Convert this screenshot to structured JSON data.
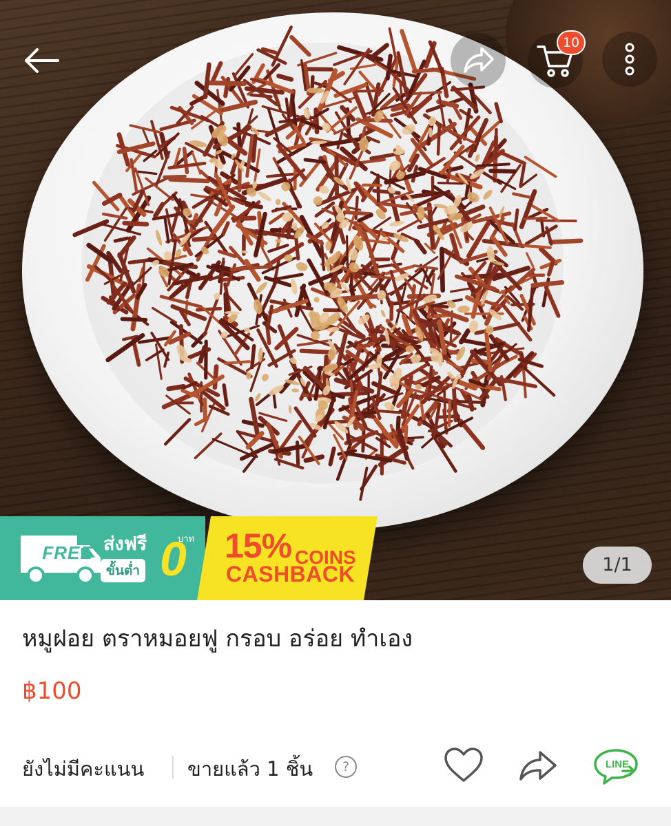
{
  "header": {
    "cart_count": "10",
    "icons": [
      "back-arrow-icon",
      "share-icon",
      "cart-icon",
      "more-vertical-icon"
    ]
  },
  "gallery": {
    "page_indicator": "1/1"
  },
  "promo": {
    "free_label": "FREE",
    "ship_free": "ส่งฟรี",
    "min_label": "ขั้นต่ำ",
    "zero": "0",
    "baht": "บาท",
    "cashback_pct": "15%",
    "cashback_coins": "COINS",
    "cashback_word": "CASHBACK",
    "colors": {
      "green": "#41b79b",
      "yellow": "#f7e324",
      "accent": "#ee4d2d"
    }
  },
  "product": {
    "title": "หมูฝอย ตราหมอยฟู กรอบ อร่อย ทำเอง",
    "price": "฿100",
    "rating_text": "ยังไม่มีคะแนน",
    "sold_text": "ขายแล้ว 1 ชิ้น",
    "help_icon_glyph": "?",
    "line_label": "LINE"
  },
  "colors": {
    "price": "#ee4d2d",
    "badge": "#ee4d2d",
    "line_green": "#3bb54a"
  }
}
